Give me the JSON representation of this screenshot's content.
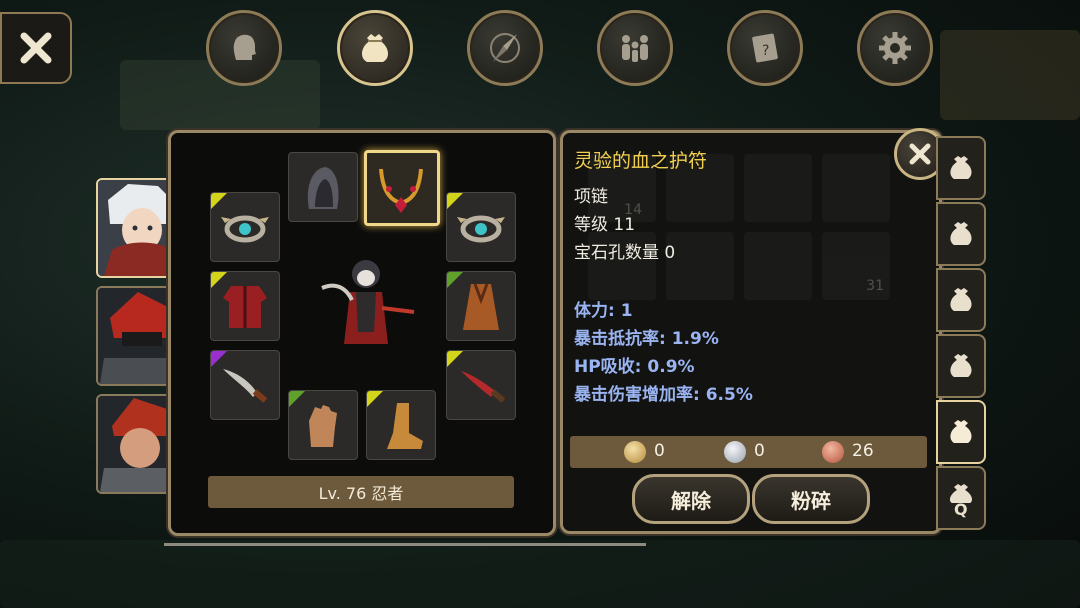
{
  "top_tabs": [
    {
      "name": "character",
      "icon": "head-icon"
    },
    {
      "name": "inventory",
      "icon": "bag-icon",
      "active": true
    },
    {
      "name": "skills",
      "icon": "compass-icon"
    },
    {
      "name": "party",
      "icon": "people-icon"
    },
    {
      "name": "quests",
      "icon": "scroll-icon"
    },
    {
      "name": "settings",
      "icon": "gear-icon"
    }
  ],
  "character": {
    "level_text": "Lv. 76 忍者"
  },
  "equipment_slots": [
    {
      "slot": "helmet",
      "icon": "hood-icon",
      "rarity": "none"
    },
    {
      "slot": "necklace",
      "icon": "necklace-icon",
      "rarity": "none",
      "selected": true
    },
    {
      "slot": "ring-left",
      "icon": "ring-icon",
      "rarity": "yellow"
    },
    {
      "slot": "ring-right",
      "icon": "ring-icon",
      "rarity": "yellow"
    },
    {
      "slot": "armor",
      "icon": "armor-icon",
      "rarity": "yellow"
    },
    {
      "slot": "cloak",
      "icon": "cloak-icon",
      "rarity": "green"
    },
    {
      "slot": "weapon-left",
      "icon": "dagger-icon",
      "rarity": "purple"
    },
    {
      "slot": "weapon-right",
      "icon": "blade-icon",
      "rarity": "yellow"
    },
    {
      "slot": "gloves",
      "icon": "glove-icon",
      "rarity": "green"
    },
    {
      "slot": "boots",
      "icon": "boot-icon",
      "rarity": "yellow"
    }
  ],
  "item_detail": {
    "name": "灵验的血之护符",
    "type": "项链",
    "level": "等级 11",
    "sockets": "宝石孔数量 0",
    "stats": [
      "体力: 1",
      "暴击抵抗率: 1.9%",
      "HP吸收: 0.9%",
      "暴击伤害增加率: 6.5%"
    ]
  },
  "ghost_counts": {
    "first": "14",
    "second": "31"
  },
  "currency": {
    "gold": "0",
    "silver": "0",
    "copper": "26"
  },
  "buttons": {
    "unequip": "解除",
    "smash": "粉碎"
  },
  "bag_tab_last_letter": "Q",
  "colors": {
    "item_name": "#f2d04f",
    "stat": "#9ab4f2",
    "gold": "#d9b25a",
    "silver": "#c7ccd4",
    "copper": "#d2785e",
    "panel_border": "#9a8866"
  }
}
